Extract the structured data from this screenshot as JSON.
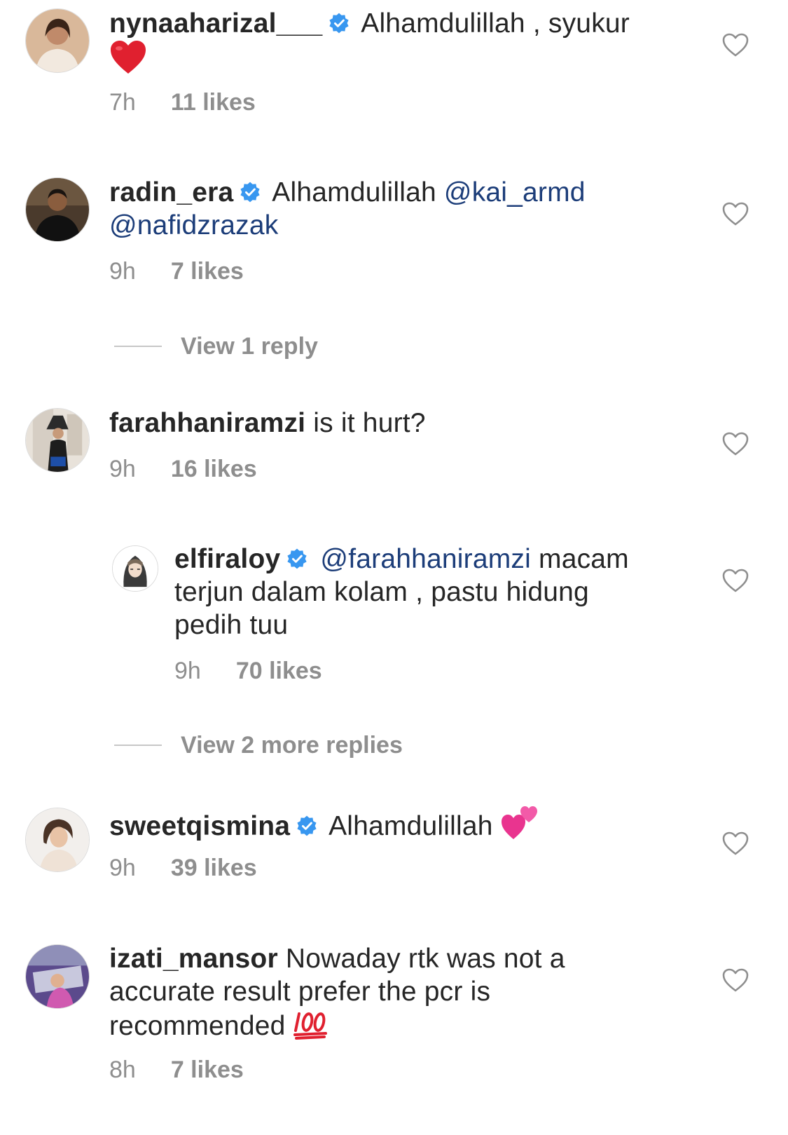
{
  "comments": [
    {
      "username": "nynaaharizal___",
      "verified": true,
      "text": "Alhamdulillah , syukur",
      "emoji": "heart-emoji",
      "time": "7h",
      "likes": "11 likes"
    },
    {
      "username": "radin_era",
      "verified": true,
      "text": "Alhamdulillah",
      "mention1": "@kai_armd",
      "mention2": "@nafidzrazak",
      "time": "9h",
      "likes": "7 likes"
    },
    {
      "username": "farahhaniramzi",
      "verified": false,
      "text": "is it hurt?",
      "time": "9h",
      "likes": "16 likes"
    },
    {
      "username": "sweetqismina",
      "verified": true,
      "text": "Alhamdulillah",
      "emoji": "two-hearts-emoji",
      "time": "9h",
      "likes": "39 likes"
    },
    {
      "username": "izati_mansor",
      "verified": false,
      "text_line1": "Nowaday rtk was not a",
      "text_line2": "accurate result prefer the pcr is",
      "text_line3": "recommended",
      "emoji": "hundred-points-emoji",
      "time": "8h",
      "likes": "7 likes"
    }
  ],
  "reply": {
    "username": "elfiraloy",
    "verified": true,
    "mention": "@farahhaniramzi",
    "text_line1": "macam",
    "text_line2": "terjun dalam kolam , pastu hidung",
    "text_line3": "pedih tuu",
    "time": "9h",
    "likes": "70 likes"
  },
  "view_replies": [
    {
      "label": "View 1 reply"
    },
    {
      "label": "View 2 more replies"
    }
  ],
  "colors": {
    "text": "#262626",
    "meta": "#8e8e8e",
    "mention": "#1c3d79",
    "verified": "#3897f0"
  }
}
